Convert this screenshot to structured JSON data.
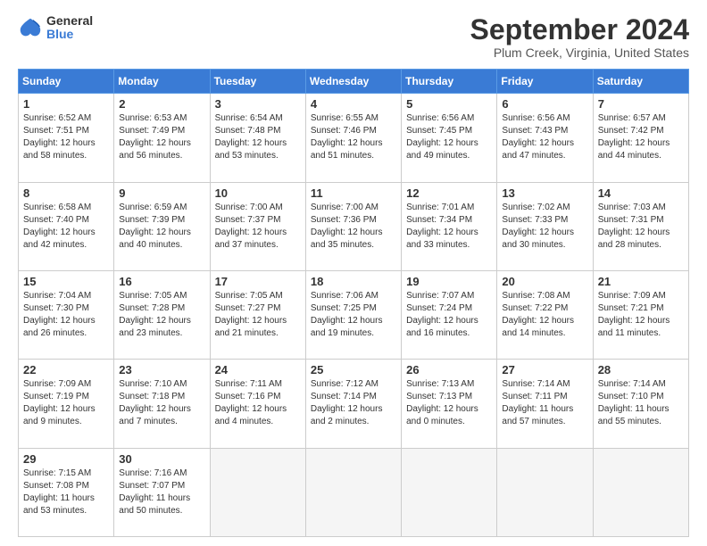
{
  "logo": {
    "general": "General",
    "blue": "Blue"
  },
  "header": {
    "month": "September 2024",
    "location": "Plum Creek, Virginia, United States"
  },
  "days_of_week": [
    "Sunday",
    "Monday",
    "Tuesday",
    "Wednesday",
    "Thursday",
    "Friday",
    "Saturday"
  ],
  "weeks": [
    [
      {
        "num": "1",
        "rise": "6:52 AM",
        "set": "7:51 PM",
        "daylight": "12 hours and 58 minutes."
      },
      {
        "num": "2",
        "rise": "6:53 AM",
        "set": "7:49 PM",
        "daylight": "12 hours and 56 minutes."
      },
      {
        "num": "3",
        "rise": "6:54 AM",
        "set": "7:48 PM",
        "daylight": "12 hours and 53 minutes."
      },
      {
        "num": "4",
        "rise": "6:55 AM",
        "set": "7:46 PM",
        "daylight": "12 hours and 51 minutes."
      },
      {
        "num": "5",
        "rise": "6:56 AM",
        "set": "7:45 PM",
        "daylight": "12 hours and 49 minutes."
      },
      {
        "num": "6",
        "rise": "6:56 AM",
        "set": "7:43 PM",
        "daylight": "12 hours and 47 minutes."
      },
      {
        "num": "7",
        "rise": "6:57 AM",
        "set": "7:42 PM",
        "daylight": "12 hours and 44 minutes."
      }
    ],
    [
      {
        "num": "8",
        "rise": "6:58 AM",
        "set": "7:40 PM",
        "daylight": "12 hours and 42 minutes."
      },
      {
        "num": "9",
        "rise": "6:59 AM",
        "set": "7:39 PM",
        "daylight": "12 hours and 40 minutes."
      },
      {
        "num": "10",
        "rise": "7:00 AM",
        "set": "7:37 PM",
        "daylight": "12 hours and 37 minutes."
      },
      {
        "num": "11",
        "rise": "7:00 AM",
        "set": "7:36 PM",
        "daylight": "12 hours and 35 minutes."
      },
      {
        "num": "12",
        "rise": "7:01 AM",
        "set": "7:34 PM",
        "daylight": "12 hours and 33 minutes."
      },
      {
        "num": "13",
        "rise": "7:02 AM",
        "set": "7:33 PM",
        "daylight": "12 hours and 30 minutes."
      },
      {
        "num": "14",
        "rise": "7:03 AM",
        "set": "7:31 PM",
        "daylight": "12 hours and 28 minutes."
      }
    ],
    [
      {
        "num": "15",
        "rise": "7:04 AM",
        "set": "7:30 PM",
        "daylight": "12 hours and 26 minutes."
      },
      {
        "num": "16",
        "rise": "7:05 AM",
        "set": "7:28 PM",
        "daylight": "12 hours and 23 minutes."
      },
      {
        "num": "17",
        "rise": "7:05 AM",
        "set": "7:27 PM",
        "daylight": "12 hours and 21 minutes."
      },
      {
        "num": "18",
        "rise": "7:06 AM",
        "set": "7:25 PM",
        "daylight": "12 hours and 19 minutes."
      },
      {
        "num": "19",
        "rise": "7:07 AM",
        "set": "7:24 PM",
        "daylight": "12 hours and 16 minutes."
      },
      {
        "num": "20",
        "rise": "7:08 AM",
        "set": "7:22 PM",
        "daylight": "12 hours and 14 minutes."
      },
      {
        "num": "21",
        "rise": "7:09 AM",
        "set": "7:21 PM",
        "daylight": "12 hours and 11 minutes."
      }
    ],
    [
      {
        "num": "22",
        "rise": "7:09 AM",
        "set": "7:19 PM",
        "daylight": "12 hours and 9 minutes."
      },
      {
        "num": "23",
        "rise": "7:10 AM",
        "set": "7:18 PM",
        "daylight": "12 hours and 7 minutes."
      },
      {
        "num": "24",
        "rise": "7:11 AM",
        "set": "7:16 PM",
        "daylight": "12 hours and 4 minutes."
      },
      {
        "num": "25",
        "rise": "7:12 AM",
        "set": "7:14 PM",
        "daylight": "12 hours and 2 minutes."
      },
      {
        "num": "26",
        "rise": "7:13 AM",
        "set": "7:13 PM",
        "daylight": "12 hours and 0 minutes."
      },
      {
        "num": "27",
        "rise": "7:14 AM",
        "set": "7:11 PM",
        "daylight": "11 hours and 57 minutes."
      },
      {
        "num": "28",
        "rise": "7:14 AM",
        "set": "7:10 PM",
        "daylight": "11 hours and 55 minutes."
      }
    ],
    [
      {
        "num": "29",
        "rise": "7:15 AM",
        "set": "7:08 PM",
        "daylight": "11 hours and 53 minutes."
      },
      {
        "num": "30",
        "rise": "7:16 AM",
        "set": "7:07 PM",
        "daylight": "11 hours and 50 minutes."
      },
      null,
      null,
      null,
      null,
      null
    ]
  ]
}
